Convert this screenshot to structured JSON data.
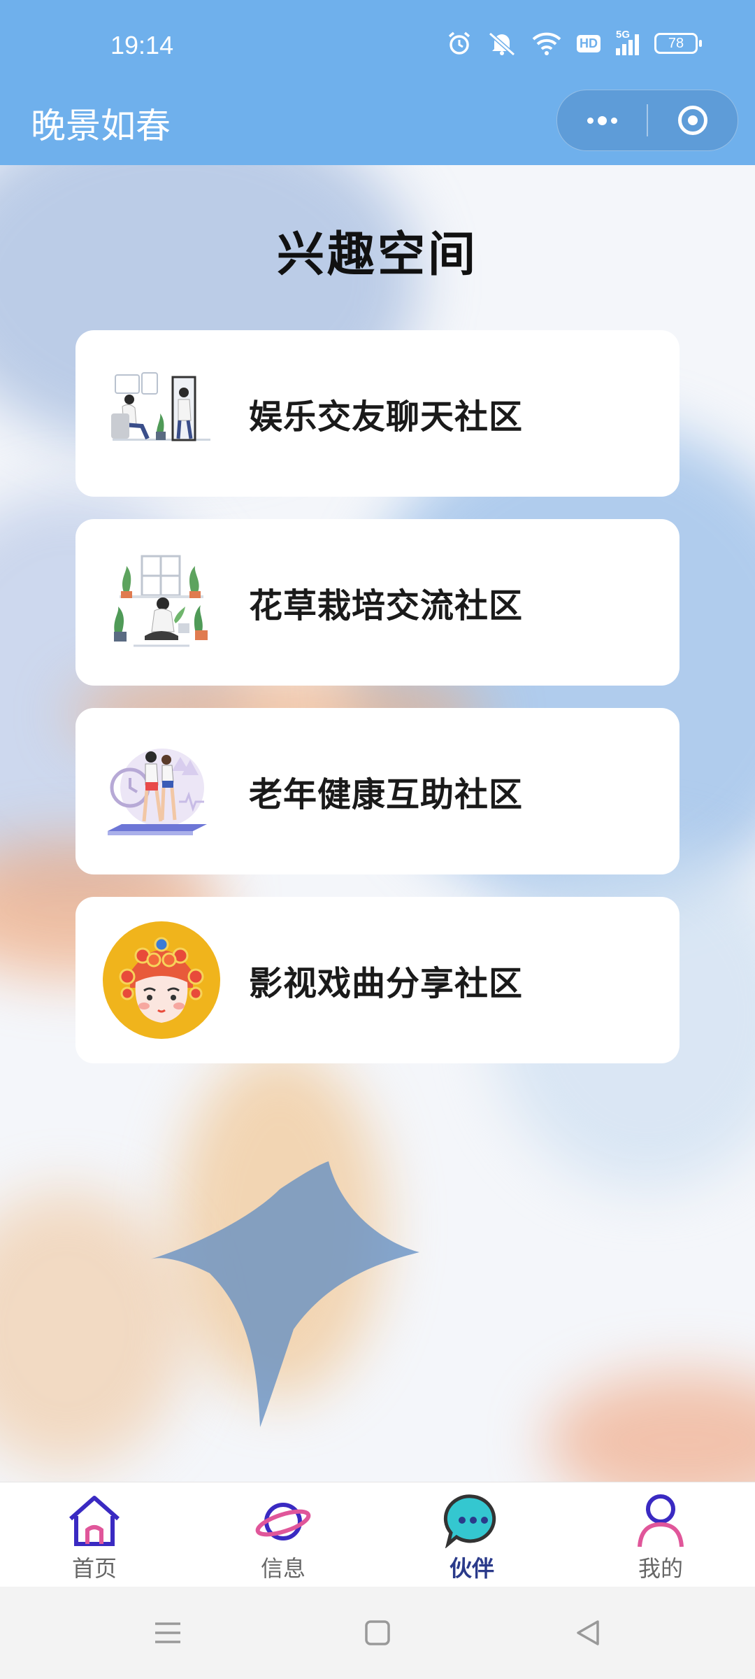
{
  "status_bar": {
    "time": "19:14",
    "network": "5G",
    "hd": "HD",
    "battery": "78",
    "icons": [
      "alarm-icon",
      "mute-icon",
      "wifi-icon",
      "hd-icon",
      "signal-icon",
      "battery-icon"
    ]
  },
  "header": {
    "title": "晚景如春",
    "menu_icon": "more-dots-icon",
    "close_icon": "target-circle-icon",
    "color": "#6fb0ec"
  },
  "main": {
    "title": "兴趣空间",
    "communities": [
      {
        "label": "娱乐交友聊天社区",
        "icon": "friends-chat-illustration"
      },
      {
        "label": "花草栽培交流社区",
        "icon": "plant-care-illustration"
      },
      {
        "label": "老年健康互助社区",
        "icon": "fitness-illustration"
      },
      {
        "label": "影视戏曲分享社区",
        "icon": "opera-face-illustration"
      }
    ]
  },
  "tabbar": {
    "tabs": [
      {
        "label": "首页",
        "icon": "home-icon",
        "active": false
      },
      {
        "label": "信息",
        "icon": "planet-icon",
        "active": false
      },
      {
        "label": "伙伴",
        "icon": "chat-bubble-icon",
        "active": true
      },
      {
        "label": "我的",
        "icon": "user-icon",
        "active": false
      }
    ]
  },
  "system_nav": {
    "buttons": [
      "menu-lines-icon",
      "square-home-icon",
      "back-triangle-icon"
    ]
  }
}
